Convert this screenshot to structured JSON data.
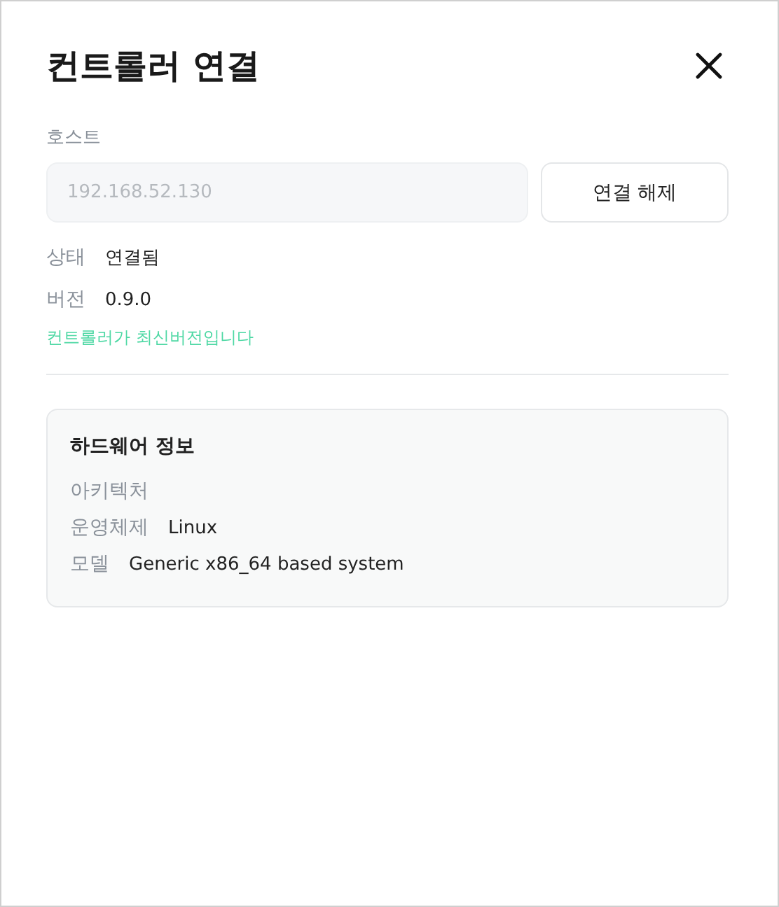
{
  "dialog": {
    "title": "컨트롤러 연결"
  },
  "host": {
    "label": "호스트",
    "value": "192.168.52.130",
    "disabled": true
  },
  "disconnect_button": "연결 해제",
  "details": [
    {
      "label": "상태",
      "value": "연결됨"
    },
    {
      "label": "버전",
      "value": "0.9.0"
    }
  ],
  "update_message": "컨트롤러가 최신버전입니다",
  "hardware": {
    "title": "하드웨어 정보",
    "rows": [
      {
        "label": "아키텍처"
      },
      {
        "label": "운영체제",
        "value": "Linux"
      },
      {
        "label": "모델",
        "value": "Generic x86_64 based system"
      }
    ]
  }
}
